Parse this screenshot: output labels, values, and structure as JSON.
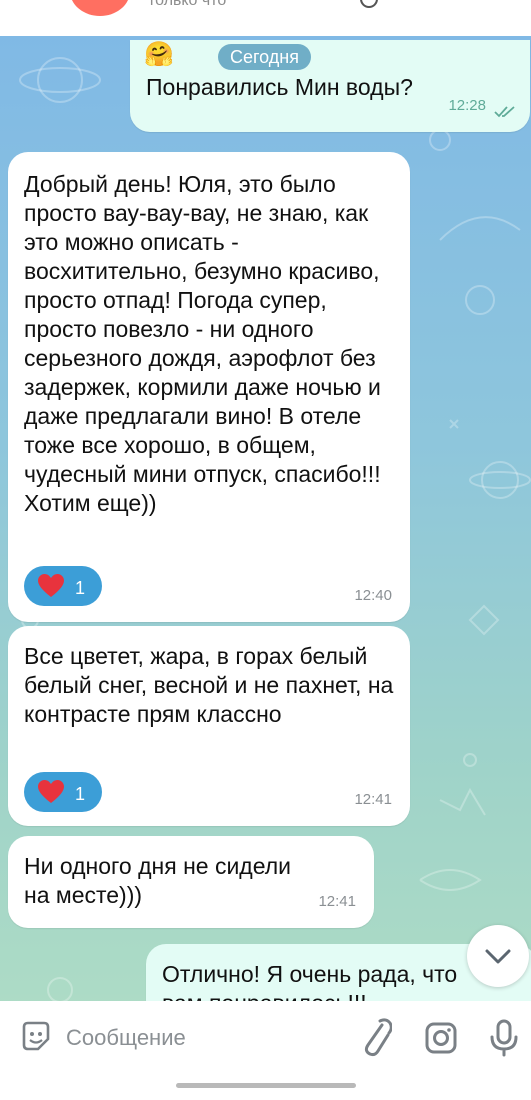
{
  "header": {
    "status": "только что"
  },
  "chat": {
    "date_pill": "Сегодня",
    "messages": [
      {
        "direction": "out",
        "emoji": "🤗",
        "text": "Понравились Мин воды?",
        "time": "12:28",
        "read": true
      },
      {
        "direction": "in",
        "text": "Добрый день! Юля, это было просто вау-вау-вау, не знаю, как это можно описать - восхитительно, безумно красиво, просто отпад! Погода супер, просто повезло - ни одного серьезного дождя, аэрофлот без задержек, кормили даже ночью и даже предлагали вино! В отеле тоже все хорошо, в общем, чудесный мини отпуск, спасибо!!! Хотим еще))",
        "reaction": {
          "emoji": "heart",
          "count": "1"
        },
        "time": "12:40"
      },
      {
        "direction": "in",
        "text": "Все цветет, жара, в горах белый белый снег, весной и не пахнет, на контрасте прям классно",
        "reaction": {
          "emoji": "heart",
          "count": "1"
        },
        "time": "12:41"
      },
      {
        "direction": "in",
        "text": "Ни одного дня не сидели на месте)))",
        "time": "12:41"
      },
      {
        "direction": "out",
        "text": "Отлично! Я очень рада, что вам понравилось!!!"
      }
    ]
  },
  "input": {
    "placeholder": "Сообщение"
  },
  "icons": {
    "sticker": "sticker-icon",
    "attach": "paperclip-icon",
    "camera": "camera-icon",
    "mic": "microphone-icon",
    "scroll": "chevron-down-icon"
  },
  "colors": {
    "reaction": "#3c9ed7",
    "outgoing_bubble": "#e3fcf5",
    "heart": "#e8333d"
  }
}
